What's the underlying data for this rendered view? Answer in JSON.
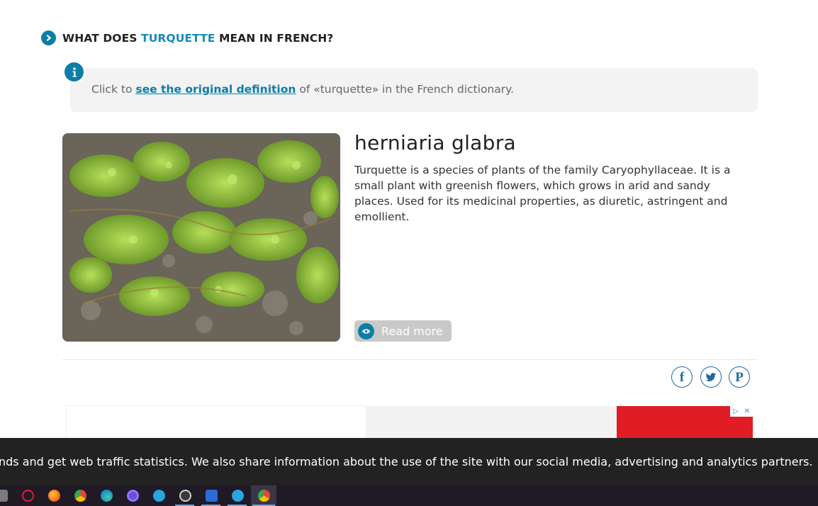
{
  "section": {
    "title_before": "WHAT DOES ",
    "title_highlight": "TURQUETTE",
    "title_after": " MEAN IN FRENCH?"
  },
  "info": {
    "text_before": "Click to ",
    "link_text": "see the original definition",
    "text_after": " of «turquette» in the French dictionary."
  },
  "card": {
    "title": "herniaria glabra",
    "description": "Turquette is a species of plants of the family Caryophyllaceae. It is a small plant with greenish flowers, which grows in arid and sandy places. Used for its medicinal properties, as diuretic, astringent and emollient.",
    "read_more_label": "Read more"
  },
  "social": {
    "icons": [
      "facebook-icon",
      "twitter-icon",
      "pinterest-icon"
    ],
    "facebook_glyph": "f",
    "pinterest_glyph": "P"
  },
  "ad": {
    "choices_glyph": "▷",
    "close_glyph": "✕"
  },
  "cookie": {
    "text": "nds and get web traffic statistics. We also share information about the use of the site with our social media, advertising and analytics partners."
  },
  "taskbar": {
    "apps": [
      "opera-icon",
      "firefox-icon",
      "chrome-icon",
      "edge-icon",
      "app-icon",
      "telegram-icon",
      "obs-icon",
      "chat-icon",
      "telegram-icon",
      "chrome-active-icon"
    ]
  },
  "colors": {
    "accent": "#0a7ea8",
    "highlight": "#1689b8",
    "cookie_bg": "#222222",
    "ad_red": "#e01c24"
  }
}
